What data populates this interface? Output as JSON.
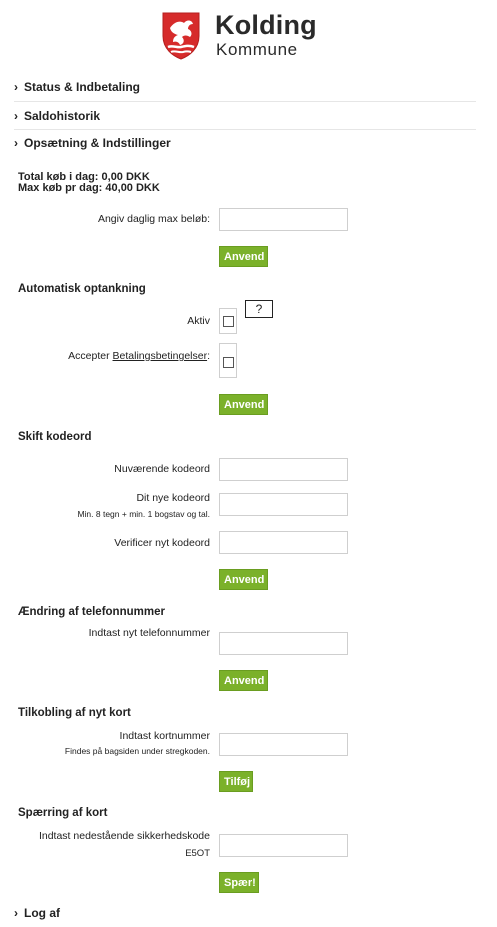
{
  "brand": {
    "line1": "Kolding",
    "line2": "Kommune"
  },
  "nav": {
    "status": "Status & Indbetaling",
    "history": "Saldohistorik",
    "settings": "Opsætning & Indstillinger",
    "logout": "Log af"
  },
  "totals": {
    "today": "Total køb i dag: 0,00 DKK",
    "max_per_day": "Max køb pr dag: 40,00 DKK"
  },
  "daily_max": {
    "label": "Angiv daglig max beløb:",
    "value": "",
    "button": "Anvend"
  },
  "auto_topup": {
    "heading": "Automatisk optankning",
    "active_label": "Aktiv",
    "help": "?",
    "accept_prefix": "Accepter ",
    "accept_link": "Betalingsbetingelser",
    "accept_suffix": ":",
    "button": "Anvend"
  },
  "password": {
    "heading": "Skift kodeord",
    "current_label": "Nuværende kodeord",
    "new_label": "Dit nye kodeord",
    "new_hint": "Min. 8 tegn + min. 1 bogstav og tal.",
    "verify_label": "Verificer nyt kodeord",
    "button": "Anvend"
  },
  "phone": {
    "heading": "Ændring af telefonnummer",
    "label": "Indtast nyt telefonnummer",
    "button": "Anvend"
  },
  "card": {
    "heading": "Tilkobling af nyt kort",
    "label": "Indtast kortnummer",
    "hint": "Findes på bagsiden under stregkoden.",
    "button": "Tilføj"
  },
  "block": {
    "heading": "Spærring af kort",
    "label": "Indtast nedestående sikkerhedskode",
    "code": "E5OT",
    "button": "Spær!"
  },
  "colors": {
    "accent_green": "#7bb12a",
    "logo_red": "#d62b2b"
  }
}
